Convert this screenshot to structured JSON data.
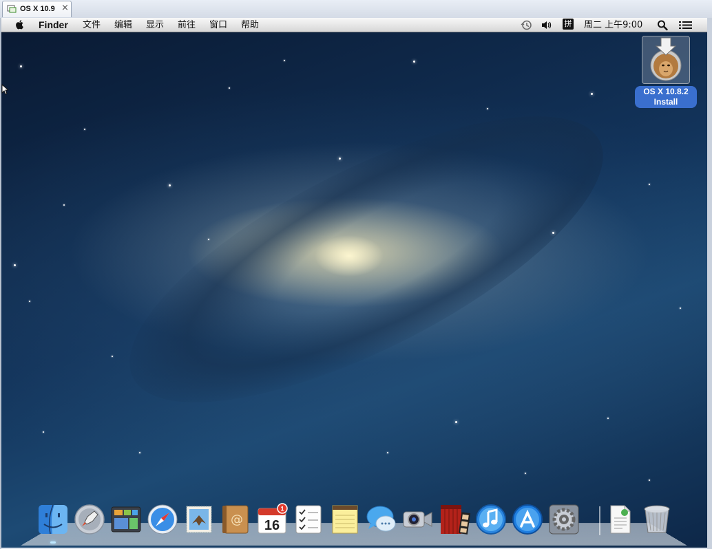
{
  "vm_tab": {
    "title": "OS X 10.9",
    "close_glyph": "×"
  },
  "menubar": {
    "app_name": "Finder",
    "menus": [
      "文件",
      "编辑",
      "显示",
      "前往",
      "窗口",
      "帮助"
    ],
    "input_method": "拼",
    "clock": "周二 上午9:00",
    "status_icons": [
      "time-machine-icon",
      "volume-icon",
      "input-method-icon",
      "spotlight-icon",
      "notification-center-icon"
    ]
  },
  "desktop_icon": {
    "line1": "OS X 10.8.2",
    "line2": "Install"
  },
  "dock": {
    "items": [
      "finder",
      "launchpad",
      "mission-control",
      "safari",
      "mail",
      "contacts",
      "calendar",
      "reminders",
      "notes",
      "messages",
      "facetime",
      "photo-booth",
      "itunes",
      "app-store",
      "system-preferences",
      "downloads",
      "trash"
    ],
    "calendar_day": "16",
    "calendar_badge": "1"
  },
  "colors": {
    "accent": "#3a6fce",
    "badge": "#e33b2e"
  }
}
